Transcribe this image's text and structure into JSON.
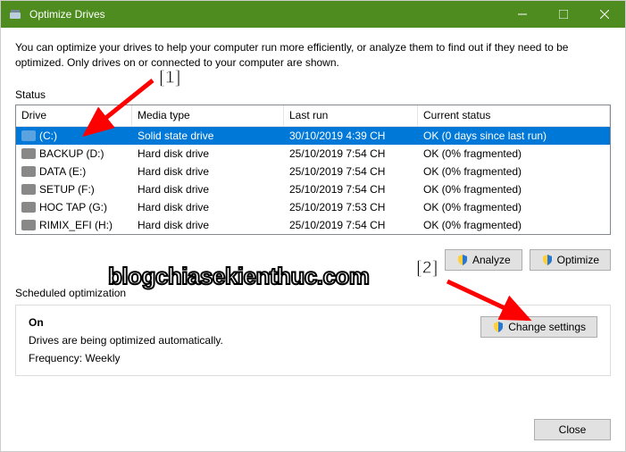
{
  "window": {
    "title": "Optimize Drives"
  },
  "description": "You can optimize your drives to help your computer run more efficiently, or analyze them to find out if they need to be optimized. Only drives on or connected to your computer are shown.",
  "status_label": "Status",
  "columns": {
    "drive": "Drive",
    "media": "Media type",
    "last": "Last run",
    "status": "Current status"
  },
  "drives": [
    {
      "name": "(C:)",
      "media": "Solid state drive",
      "last": "30/10/2019 4:39 CH",
      "status": "OK (0 days since last run)",
      "selected": true,
      "ssd": true
    },
    {
      "name": "BACKUP (D:)",
      "media": "Hard disk drive",
      "last": "25/10/2019 7:54 CH",
      "status": "OK (0% fragmented)"
    },
    {
      "name": "DATA (E:)",
      "media": "Hard disk drive",
      "last": "25/10/2019 7:54 CH",
      "status": "OK (0% fragmented)"
    },
    {
      "name": "SETUP (F:)",
      "media": "Hard disk drive",
      "last": "25/10/2019 7:54 CH",
      "status": "OK (0% fragmented)"
    },
    {
      "name": "HOC TAP (G:)",
      "media": "Hard disk drive",
      "last": "25/10/2019 7:53 CH",
      "status": "OK (0% fragmented)"
    },
    {
      "name": "RIMIX_EFI (H:)",
      "media": "Hard disk drive",
      "last": "25/10/2019 7:54 CH",
      "status": "OK (0% fragmented)"
    }
  ],
  "buttons": {
    "analyze": "Analyze",
    "optimize": "Optimize",
    "change": "Change settings",
    "close": "Close"
  },
  "sched": {
    "label": "Scheduled optimization",
    "on": "On",
    "desc": "Drives are being optimized automatically.",
    "freq": "Frequency: Weekly"
  },
  "watermark": "blogchiasekienthuc.com",
  "anno1": "[1]",
  "anno2": "[2]",
  "shield_colors": {
    "y": "#ffd03a",
    "b": "#2678d4"
  }
}
